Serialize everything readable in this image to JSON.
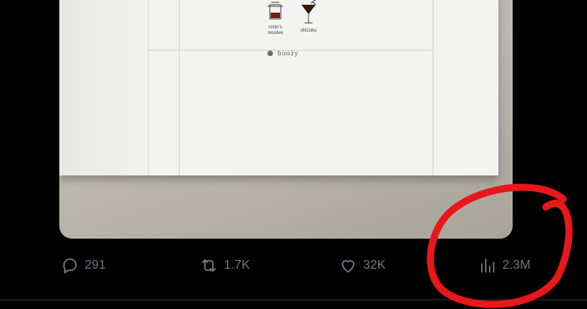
{
  "photo": {
    "drinks": [
      {
        "line1": "ronin's",
        "line2": "resolve"
      },
      {
        "line1": "shizuku",
        "line2": ""
      }
    ],
    "section_label": "boozy"
  },
  "actions": {
    "replies": "291",
    "reposts": "1.7K",
    "likes": "32K",
    "views": "2.3M"
  },
  "icons": [
    "reply-icon",
    "repost-icon",
    "like-icon",
    "views-icon"
  ],
  "colors": {
    "background": "#000000",
    "action_text": "#71767b",
    "annotation": "#e8171b"
  }
}
